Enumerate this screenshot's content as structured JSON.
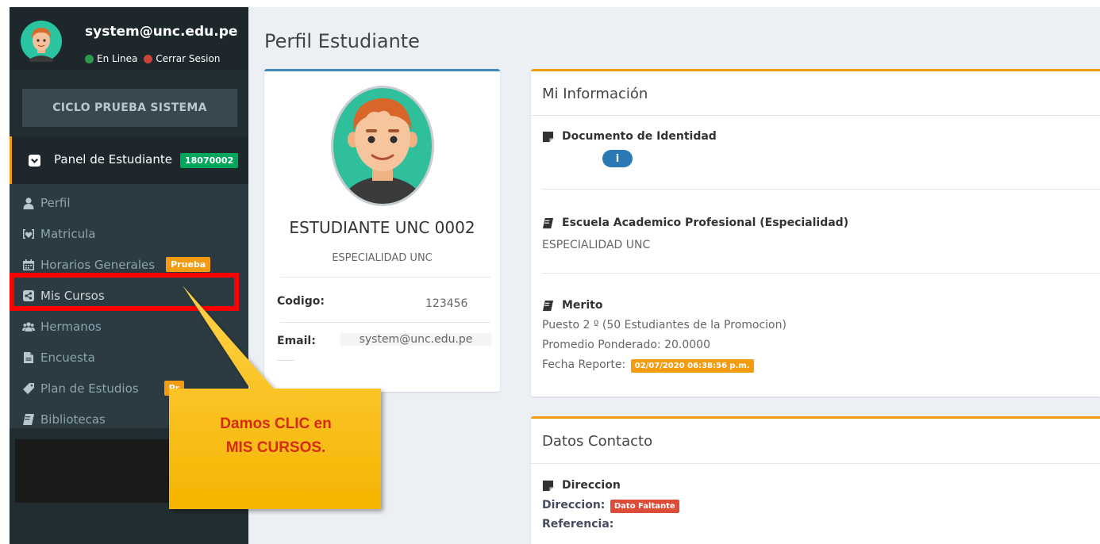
{
  "sidebar": {
    "user": {
      "email": "system@unc.edu.pe",
      "status_online": "En Linea",
      "status_logout": "Cerrar Sesion"
    },
    "ciclo_button": "CICLO PRUEBA SISTEMA",
    "panel": {
      "title": "Panel de Estudiante",
      "badge": "18070002"
    },
    "menu": [
      {
        "label": "Perfil",
        "icon": "user-icon"
      },
      {
        "label": "Matricula",
        "icon": "matricula-icon"
      },
      {
        "label": "Horarios Generales",
        "icon": "calendar-icon",
        "badge": "Prueba"
      },
      {
        "label": "Mis Cursos",
        "icon": "share-square-icon"
      },
      {
        "label": "Hermanos",
        "icon": "users-icon"
      },
      {
        "label": "Encuesta",
        "icon": "file-icon"
      },
      {
        "label": "Plan de Estudios",
        "icon": "tag-icon",
        "badge": "Pr"
      },
      {
        "label": "Bibliotecas",
        "icon": "book-icon"
      }
    ]
  },
  "annotation": {
    "line1": "Damos CLIC en",
    "line2": "MIS CURSOS."
  },
  "page": {
    "title": "Perfil Estudiante"
  },
  "profile": {
    "name": "ESTUDIANTE UNC 0002",
    "specialty": "ESPECIALIDAD UNC",
    "codigo_label": "Codigo:",
    "codigo_value": "123456",
    "email_label": "Email:",
    "email_value": "system@unc.edu.pe"
  },
  "info": {
    "title": "Mi Información",
    "doc_title": "Documento de Identidad",
    "doc_pill": "i",
    "school_title": "Escuela Academico Profesional (Especialidad)",
    "school_value": "ESPECIALIDAD UNC",
    "merit_title": "Merito",
    "merit_rank": "Puesto 2 º (50 Estudiantes de la Promocion)",
    "merit_avg": "Promedio Ponderado: 20.0000",
    "merit_date_label": "Fecha Reporte:",
    "merit_date_value": "02/07/2020 06:38:56 p.m."
  },
  "contact": {
    "title": "Datos Contacto",
    "address_title": "Direccion",
    "address_label": "Direccion:",
    "address_badge": "Dato Faltante",
    "reference_label": "Referencia:"
  },
  "colors": {
    "sidebar_bg": "#222d32",
    "accent_orange": "#f39c12",
    "accent_green": "#00a65a",
    "accent_blue": "#3c8dbc",
    "highlight_red": "#ff0000",
    "callout_yellow": "#ffc000"
  }
}
